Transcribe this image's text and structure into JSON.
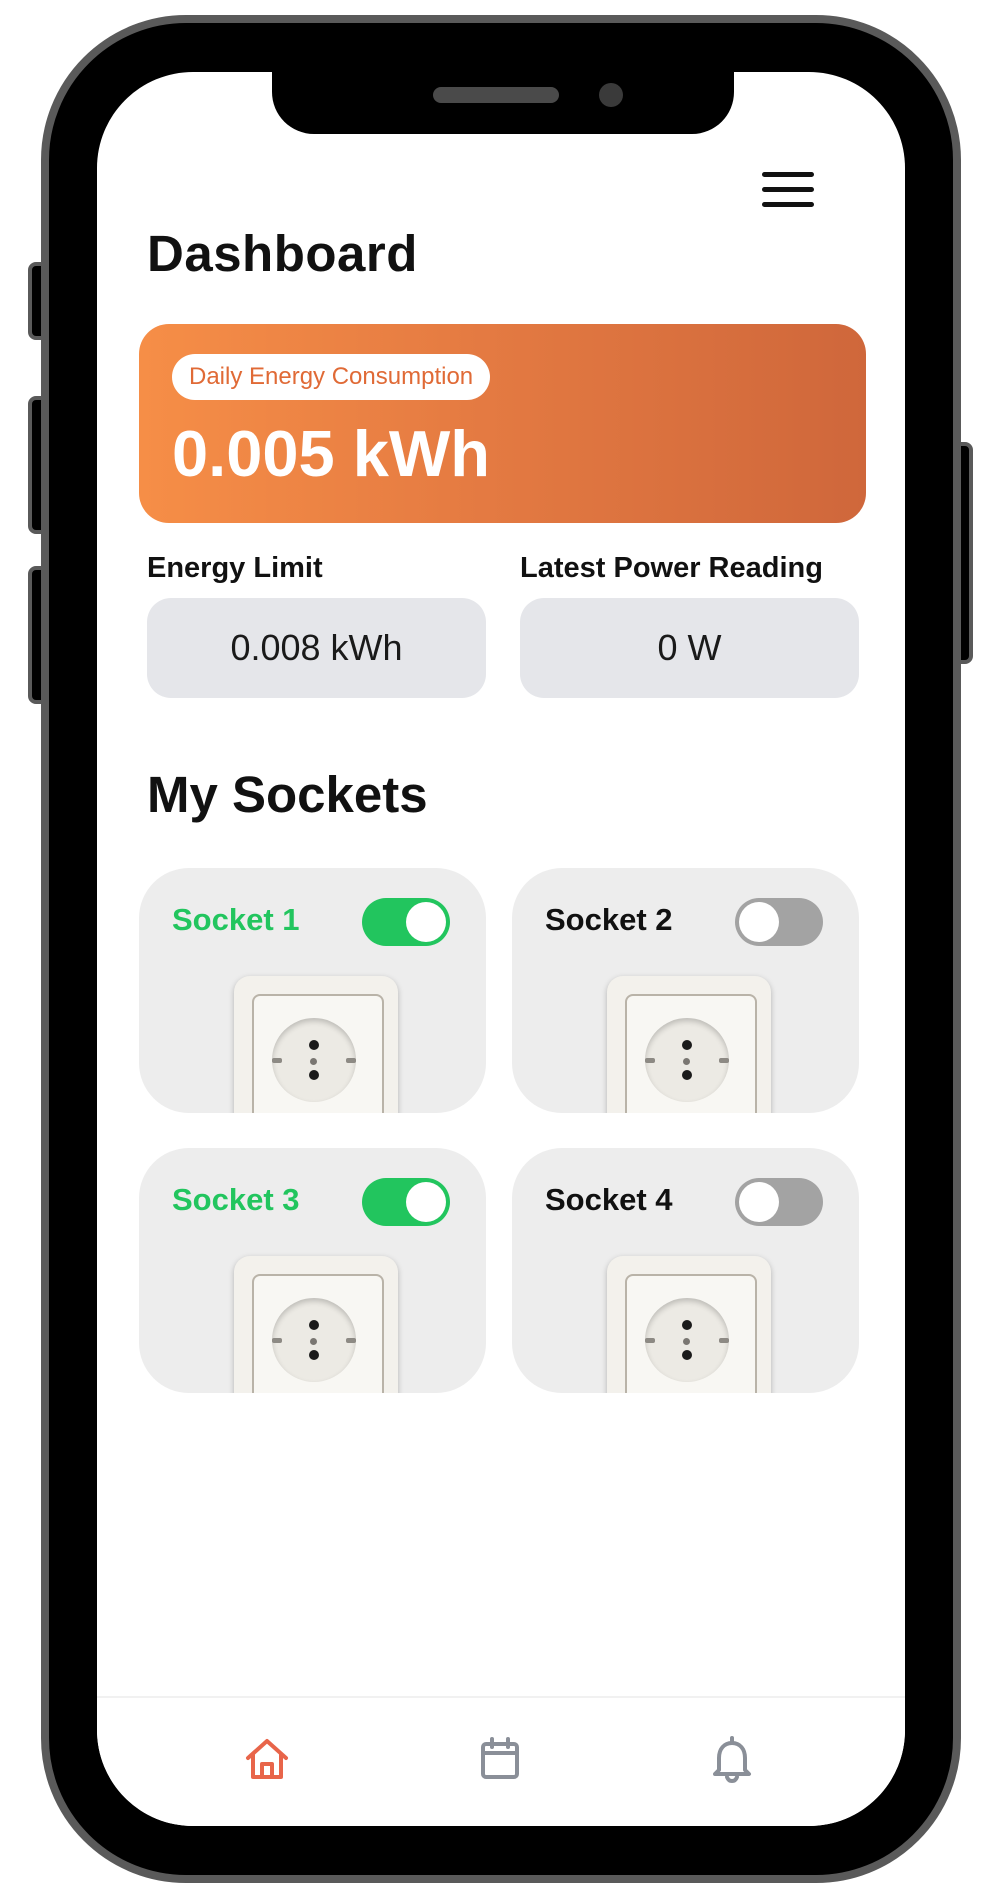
{
  "header": {
    "title": "Dashboard",
    "menu_icon": "hamburger-menu-icon"
  },
  "energy": {
    "label": "Daily Energy Consumption",
    "value": "0.005 kWh"
  },
  "stats": {
    "limit_label": "Energy Limit",
    "limit_value": "0.008 kWh",
    "power_label": "Latest Power Reading",
    "power_value": "0 W"
  },
  "sockets_section": {
    "title": "My Sockets"
  },
  "sockets": [
    {
      "name": "Socket 1",
      "on": true
    },
    {
      "name": "Socket 2",
      "on": false
    },
    {
      "name": "Socket 3",
      "on": true
    },
    {
      "name": "Socket 4",
      "on": false
    }
  ],
  "colors": {
    "accent_orange": "#f68e47",
    "accent_orange_dark": "#cf673b",
    "on_green": "#22c55e",
    "off_gray": "#a3a3a3",
    "nav_active": "#e8654a",
    "nav_inactive": "#8a8f98"
  },
  "nav": [
    {
      "icon": "home-icon",
      "active": true
    },
    {
      "icon": "calendar-icon",
      "active": false
    },
    {
      "icon": "bell-icon",
      "active": false
    }
  ]
}
